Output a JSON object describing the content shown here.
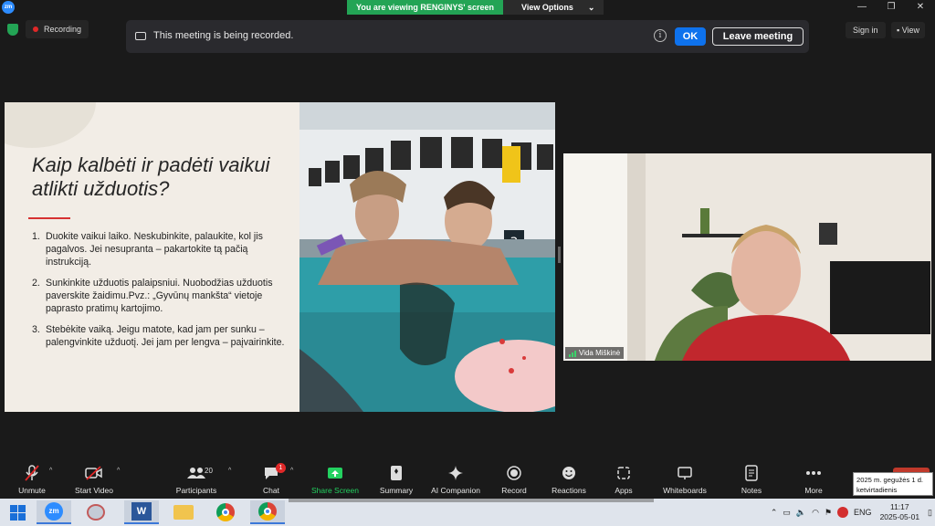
{
  "window": {
    "logo_text": "zm",
    "share_banner": "You are viewing RENGINYS' screen",
    "view_options": "View Options",
    "view_options_caret": "⌄",
    "minimize": "—",
    "restore": "❐",
    "close": "✕"
  },
  "recording": {
    "label": "Recording",
    "notice": "This meeting is being recorded.",
    "info": "i",
    "ok": "OK",
    "leave": "Leave meeting"
  },
  "header_right": {
    "sign_in": "Sign in",
    "view": "View"
  },
  "slide": {
    "title": "Kaip kalbėti ir padėti vaikui atlikti užduotis?",
    "items": [
      {
        "n": "1.",
        "text": "Duokite vaikui laiko. Neskubinkite, palaukite, kol jis pagalvos. Jei nesupranta – pakartokite tą pačią instrukciją."
      },
      {
        "n": "2.",
        "text": "Sunkinkite užduotis palaipsniui. Nuobodžias užduotis paverskite žaidimu.Pvz.: „Gyvūnų mankšta“ vietoje paprasto pratimų kartojimo."
      },
      {
        "n": "3.",
        "text": "Stebėkite vaiką. Jeigu matote, kad jam per sunku – palengvinkite užduotį. Jei jam per lengva – paįvairinkite."
      }
    ]
  },
  "participant": {
    "name": "Vida Miškinė"
  },
  "toolbar": {
    "unmute": "Unmute",
    "start_video": "Start Video",
    "participants": "Participants",
    "participants_count": "20",
    "chat": "Chat",
    "chat_badge": "1",
    "share_screen": "Share Screen",
    "summary": "Summary",
    "ai_companion": "AI Companion",
    "record": "Record",
    "reactions": "Reactions",
    "apps": "Apps",
    "whiteboards": "Whiteboards",
    "notes": "Notes",
    "more": "More",
    "caret": "^"
  },
  "tooltip": {
    "date_long": "2025 m. gegužės 1 d. ketvirtadienis"
  },
  "taskbar": {
    "lang": "ENG",
    "time": "11:17",
    "date": "2025-05-01",
    "word_label": "W",
    "zoom_label": "zm"
  },
  "colors": {
    "accent_blue": "#0e72ed",
    "share_green": "#23a455",
    "slide_bg": "#f2ede6",
    "rec_red": "#e02828"
  }
}
